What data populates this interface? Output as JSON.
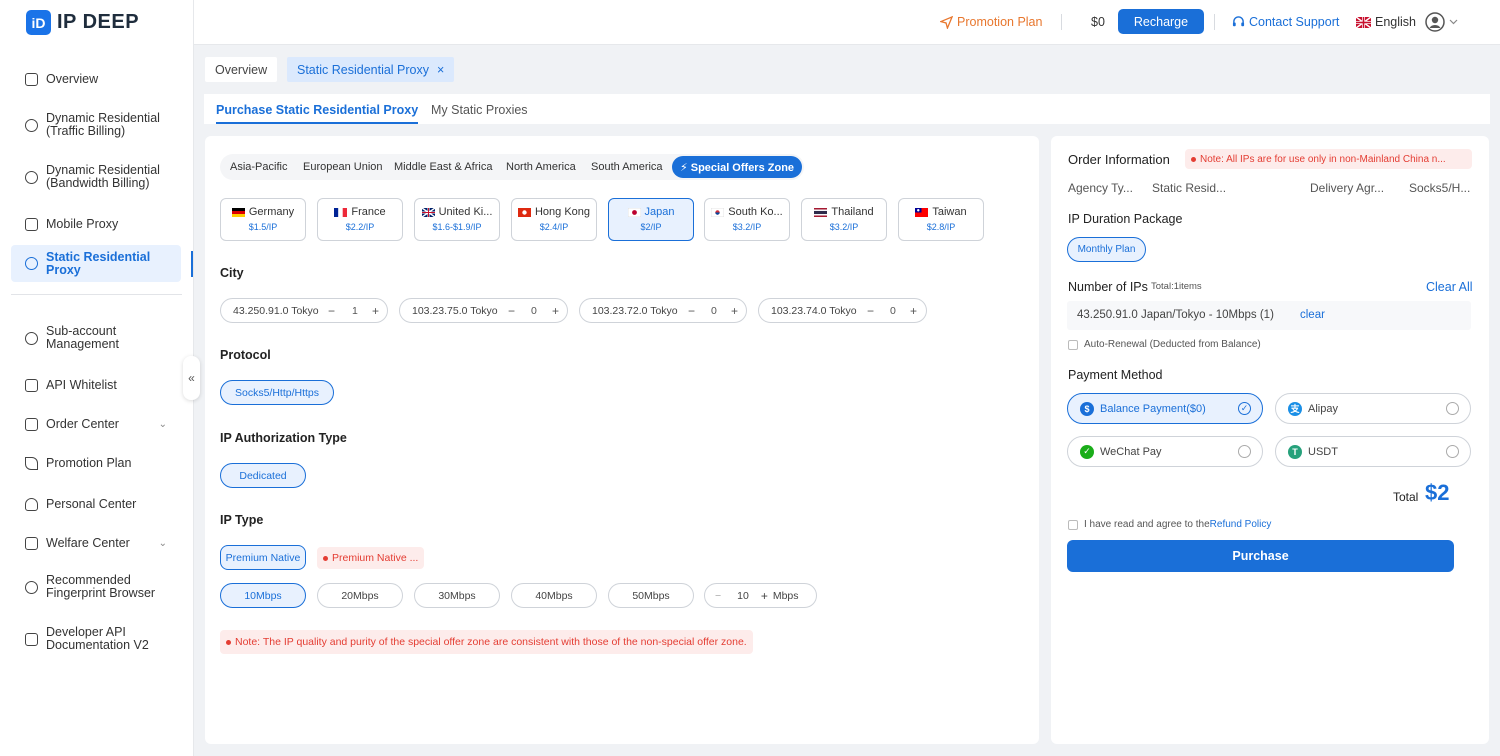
{
  "brand": {
    "logo_mark": "iD",
    "name": "IP DEEP"
  },
  "sidebar": {
    "items": [
      {
        "label": "Overview",
        "icon": "window-icon"
      },
      {
        "label": "Dynamic Residential (Traffic Billing)",
        "icon": "location-user-icon"
      },
      {
        "label": "Dynamic Residential (Bandwidth Billing)",
        "icon": "location-group-icon"
      },
      {
        "label": "Mobile Proxy",
        "icon": "mobile-icon"
      },
      {
        "label": "Static Residential Proxy",
        "icon": "location-pin-icon"
      },
      {
        "label": "Sub-account Management",
        "icon": "users-icon"
      },
      {
        "label": "API Whitelist",
        "icon": "document-gear-icon"
      },
      {
        "label": "Order Center",
        "icon": "clipboard-icon"
      },
      {
        "label": "Promotion Plan",
        "icon": "send-icon"
      },
      {
        "label": "Personal Center",
        "icon": "user-icon"
      },
      {
        "label": "Welfare Center",
        "icon": "gift-icon"
      },
      {
        "label": "Recommended Fingerprint Browser",
        "icon": "fingerprint-icon"
      },
      {
        "label": "Developer API Documentation V2",
        "icon": "doc-icon"
      }
    ],
    "collapse_glyph": "«",
    "chevron": "⌄"
  },
  "header": {
    "promotion": "Promotion Plan",
    "balance": "$0",
    "recharge": "Recharge",
    "support": "Contact Support",
    "language": "English"
  },
  "page_tabs": [
    {
      "label": "Overview"
    },
    {
      "label": "Static Residential Proxy",
      "close": "×"
    }
  ],
  "sub_tabs": [
    "Purchase Static Residential Proxy",
    "My Static Proxies"
  ],
  "regions": [
    "Asia-Pacific",
    "European Union",
    "Middle East & Africa",
    "North America",
    "South America"
  ],
  "special_zone": "⚡ Special Offers Zone",
  "countries": [
    {
      "name": "Germany",
      "price": "$1.5/IP"
    },
    {
      "name": "France",
      "price": "$2.2/IP"
    },
    {
      "name": "United Ki...",
      "price": "$1.6-$1.9/IP"
    },
    {
      "name": "Hong Kong",
      "price": "$2.4/IP"
    },
    {
      "name": "Japan",
      "price": "$2/IP"
    },
    {
      "name": "South Ko...",
      "price": "$3.2/IP"
    },
    {
      "name": "Thailand",
      "price": "$3.2/IP"
    },
    {
      "name": "Taiwan",
      "price": "$2.8/IP"
    }
  ],
  "labels": {
    "city": "City",
    "protocol": "Protocol",
    "auth_type": "IP Authorization Type",
    "ip_type": "IP Type"
  },
  "cities": [
    {
      "name": "43.250.91.0 Tokyo",
      "qty": "1"
    },
    {
      "name": "103.23.75.0 Tokyo",
      "qty": "0"
    },
    {
      "name": "103.23.72.0 Tokyo",
      "qty": "0"
    },
    {
      "name": "103.23.74.0 Tokyo",
      "qty": "0"
    }
  ],
  "stepper": {
    "minus": "−",
    "plus": "+"
  },
  "protocol": "Socks5/Http/Https",
  "auth_type": "Dedicated",
  "ip_type": {
    "selected": "Premium Native",
    "other": "Premium Native ..."
  },
  "bandwidth": [
    "10Mbps",
    "20Mbps",
    "30Mbps",
    "40Mbps",
    "50Mbps"
  ],
  "bandwidth_custom": {
    "value": "10",
    "unit": "Mbps"
  },
  "note": "Note: The IP quality and purity of the special offer zone are consistent with those of the non-special offer zone.",
  "order": {
    "title": "Order Information",
    "note": "Note: All IPs are for use only in non-Mainland China n...",
    "agency_label": "Agency Ty...",
    "agency_value": "Static Resid...",
    "delivery_label": "Delivery Agr...",
    "delivery_value": "Socks5/H...",
    "duration_title": "IP Duration Package",
    "duration": "Monthly Plan",
    "ips_title": "Number of IPs",
    "ips_total": "Total:1items",
    "clear_all": "Clear All",
    "ip_item": "43.250.91.0 Japan/Tokyo - 10Mbps (1)",
    "clear": "clear",
    "auto_renewal": "Auto-Renewal (Deducted from Balance)",
    "payment_title": "Payment Method",
    "payments": [
      "Balance Payment($0)",
      "Alipay",
      "WeChat Pay",
      "USDT"
    ],
    "total_label": "Total",
    "total_value": "$2",
    "agree": "I have read and agree to the",
    "refund": "Refund Policy",
    "purchase": "Purchase"
  },
  "colors": {
    "accent": "#1a6fd8",
    "promo": "#e8772e",
    "danger": "#e43d33"
  }
}
